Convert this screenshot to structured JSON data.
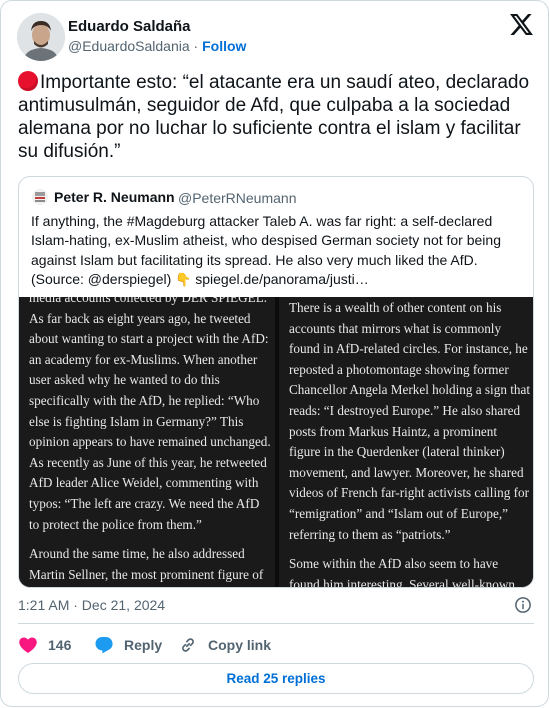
{
  "author": {
    "name": "Eduardo Saldaña",
    "handle": "@EduardoSaldania",
    "separator": "·",
    "follow_label": "Follow"
  },
  "tweet": {
    "text": "Importante esto: “el atacante era un saudí ateo, declarado antimusulmán, seguidor de Afd, que culpaba a la sociedad alemana por no luchar lo suficiente contra el islam y facilitar su difusión.”",
    "emoji": "red-circle"
  },
  "quote": {
    "name": "Peter R. Neumann",
    "handle": "@PeterRNeumann",
    "text": "If anything, the #Magdeburg attacker Taleb A. was far right: a self-declared Islam-hating, ex-Muslim atheist, who despised German society not for being against Islam but facilitating its spread. He also very much liked the AfD. (Source: @derspiegel) ",
    "emoji": "👇",
    "link": "spiegel.de/panorama/justi…",
    "image": {
      "left_paragraphs": [
        "media accounts collected by DER SPIEGEL. As far back as eight years ago, he tweeted about wanting to start a project with the AfD: an academy for ex-Muslims. When another user asked why he wanted to do this specifically with the AfD, he replied: “Who else is fighting Islam in Germany?” This opinion appears to have remained unchanged. As recently as June of this year, he retweeted AfD leader Alice Weidel, commenting with typos: “The left are crazy. We need the AfD to protect the police from them.”",
        "Around the same time, he also addressed Martin Sellner, the most prominent figure of the far-right Identitarian Movement, in tweets. Additionally, he retweeted far-right AfD-affiliated"
      ],
      "right_paragraphs": [
        "There is a wealth of other content on his accounts that mirrors what is commonly found in AfD-related circles. For instance, he reposted a photomontage showing former Chancellor Angela Merkel holding a sign that reads: “I destroyed Europe.” He also shared posts from Markus Haintz, a prominent figure in the Querdenker (lateral thinker) movement, and lawyer. Moreover, he shared videos of French far-right activists calling for “remigration” and “Islam out of Europe,” referring to them as “patriots.”",
        "Some within the AfD also seem to have found him interesting. Several well-known officials of"
      ]
    }
  },
  "meta": {
    "timestamp": "1:21 AM · Dec 21, 2024"
  },
  "actions": {
    "like_count": "146",
    "reply_label": "Reply",
    "copy_label": "Copy link"
  },
  "footer": {
    "read_replies_label": "Read 25 replies"
  },
  "colors": {
    "link_blue": "#006fd6",
    "like_pink": "#f91880",
    "reply_blue": "#1d9bf0",
    "muted_gray": "#536471",
    "border": "#cfd9de"
  },
  "icons": [
    "x-logo-icon",
    "red-circle-icon",
    "info-icon",
    "heart-icon",
    "reply-bubble-icon",
    "link-icon",
    "pointing-down-icon"
  ]
}
